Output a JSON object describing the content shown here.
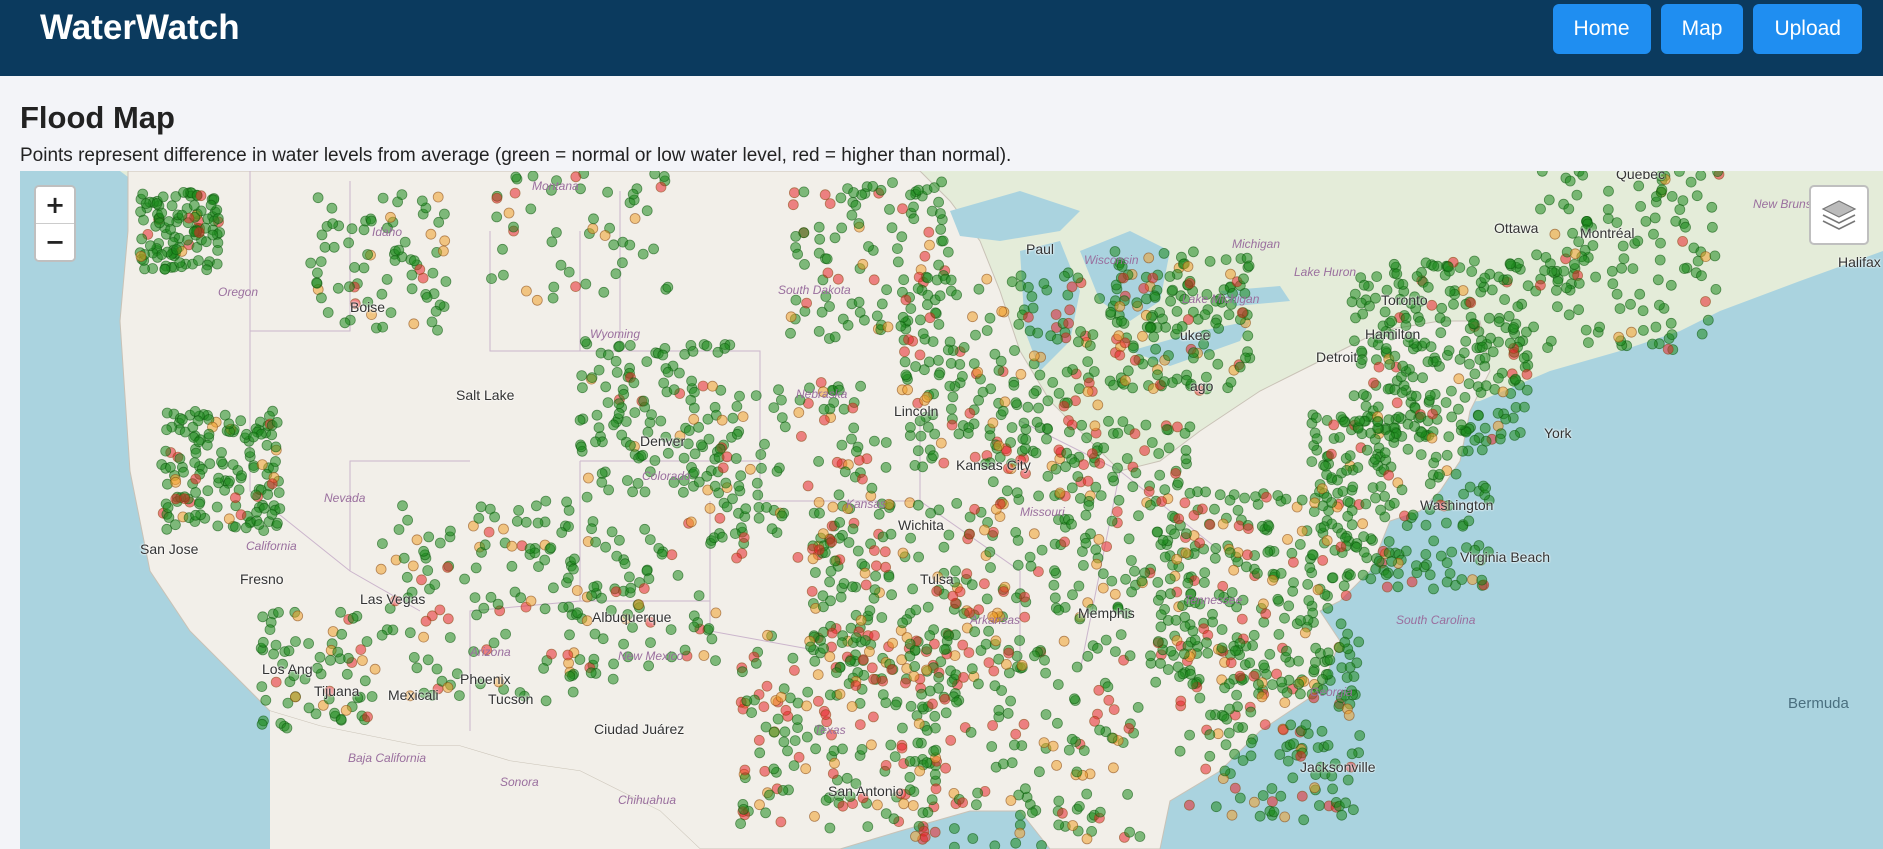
{
  "header": {
    "brand": "WaterWatch",
    "nav": [
      {
        "label": "Home"
      },
      {
        "label": "Map"
      },
      {
        "label": "Upload"
      }
    ]
  },
  "page": {
    "title": "Flood Map",
    "description": "Points represent difference in water levels from average (green = normal or low water level, red = higher than normal)."
  },
  "map": {
    "zoom_in": "+",
    "zoom_out": "−",
    "layers_icon": "layers-icon",
    "colors": {
      "water": "#aad3df",
      "land": "#f2efe9",
      "canada": "#e4ecd9",
      "marker_green": "#1e8a1e",
      "marker_orange": "#f0a12c",
      "marker_red": "#e8242a"
    },
    "labels": {
      "quebec": "Québec",
      "ottawa": "Ottawa",
      "montreal": "Montréal",
      "new_brunswick": "New Brunsw",
      "halifax": "Halifax",
      "toronto": "Toronto",
      "hamilton": "Hamilton",
      "lake_huron": "Lake Huron",
      "lake_michigan": "Lake Michigan",
      "montana": "Montana",
      "idaho": "Idaho",
      "oregon": "Oregon",
      "wyoming": "Wyoming",
      "south_dakota": "South Dakota",
      "nebraska": "Nebraska",
      "nevada": "Nevada",
      "colorado": "Colorado",
      "kansas": "Kansas",
      "missouri": "Missouri",
      "arizona": "Arizona",
      "new_mexico": "New Mexico",
      "texas": "Texas",
      "tennessee": "Tennessee",
      "south_carolina": "South Carolina",
      "georgia": "Georgia",
      "salt_lake": "Salt Lake",
      "las_vegas": "Las Vegas",
      "fresno": "Fresno",
      "san_jose": "San Jose",
      "los_angeles": "Los Ang",
      "tijuana": "Tijuana",
      "mexicali": "Mexicali",
      "phoenix": "Phoenix",
      "tucson": "Tucson",
      "ciudad_juarez": "Ciudad Juárez",
      "albuquerque": "Albuquerque",
      "lincoln": "Lincoln",
      "wichita": "Wichita",
      "tulsa": "Tulsa",
      "memphis": "Memphis",
      "virginia_beach": "Virginia Beach",
      "washington": "Washington",
      "new_york": "York",
      "detroit": "Detroit",
      "chicago": "ago",
      "milwaukee": "ukee",
      "minneapolis": "Paul",
      "wisconsin": "Wisconsin",
      "michigan": "Michigan",
      "jacksonville": "Jacksonville",
      "bermuda": "Bermuda",
      "baja_california": "Baja California",
      "sonora": "Sonora",
      "chihuahua": "Chihuahua",
      "san_antonio": "San Antonio",
      "kansas_city": "Kansas City",
      "denver": "Denver",
      "boise": "Boise",
      "california": "California",
      "arkansas": "Arkansas"
    }
  }
}
